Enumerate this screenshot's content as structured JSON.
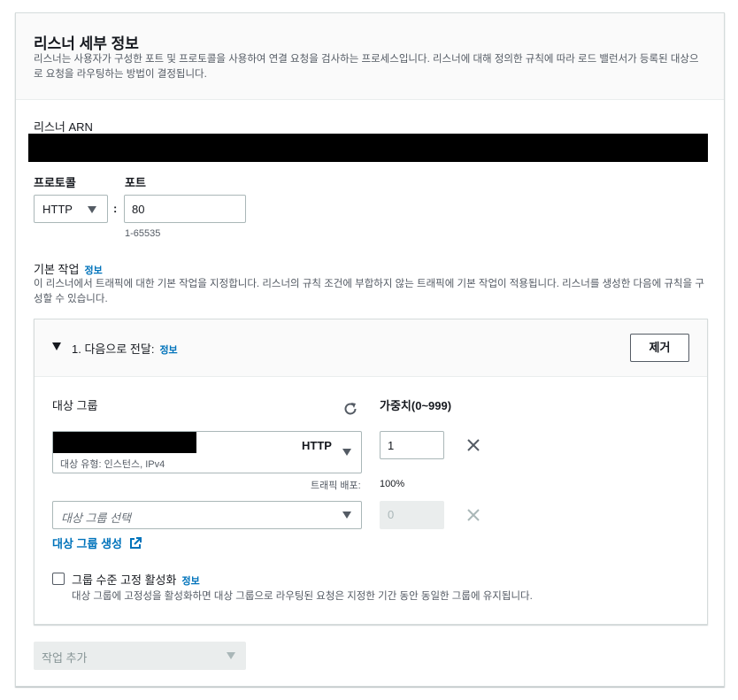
{
  "panel": {
    "title": "리스너 세부 정보",
    "description": "리스너는 사용자가 구성한 포트 및 프로토콜을 사용하여 연결 요청을 검사하는 프로세스입니다. 리스너에 대해 정의한 규칙에 따라 로드 밸런서가 등록된 대상으로 요청을 라우팅하는 방법이 결정됩니다."
  },
  "arn": {
    "label": "리스너 ARN"
  },
  "protocol": {
    "label": "프로토콜",
    "value": "HTTP"
  },
  "port": {
    "label": "포트",
    "separator": ":",
    "value": "80",
    "hint": "1-65535"
  },
  "default_action": {
    "label": "기본 작업",
    "info": "정보",
    "description": "이 리스너에서 트래픽에 대한 기본 작업을 지정합니다. 리스너의 규칙 조건에 부합하지 않는 트래픽에 기본 작업이 적용됩니다. 리스너를 생성한 다음에 규칙을 구성할 수 있습니다."
  },
  "action": {
    "title": "1. 다음으로 전달:",
    "info": "정보",
    "remove_label": "제거",
    "target_group_label": "대상 그룹",
    "weight_label": "가중치(0~999)",
    "row1": {
      "protocol": "HTTP",
      "subtext": "대상 유형: 인스턴스, IPv4",
      "weight": "1",
      "traffic_label": "트래픽 배포:",
      "traffic_value": "100%"
    },
    "row2": {
      "placeholder": "대상 그룹 선택",
      "weight": "0"
    },
    "create_link": "대상 그룹 생성",
    "stickiness_label": "그룹 수준 고정 활성화",
    "stickiness_info": "정보",
    "stickiness_desc": "대상 그룹에 고정성을 활성화하면 대상 그룹으로 라우팅된 요청은 지정한 기간 동안 동일한 그룹에 유지됩니다."
  },
  "add_action": {
    "label": "작업 추가"
  },
  "colors": {
    "link": "#0073bb",
    "text": "#16191f",
    "muted": "#545b64",
    "border": "#d5dbdb",
    "disabled": "#eaeded"
  },
  "icons": [
    "refresh-icon",
    "close-icon",
    "external-link-icon",
    "caret-down-icon",
    "triangle-down-icon"
  ]
}
